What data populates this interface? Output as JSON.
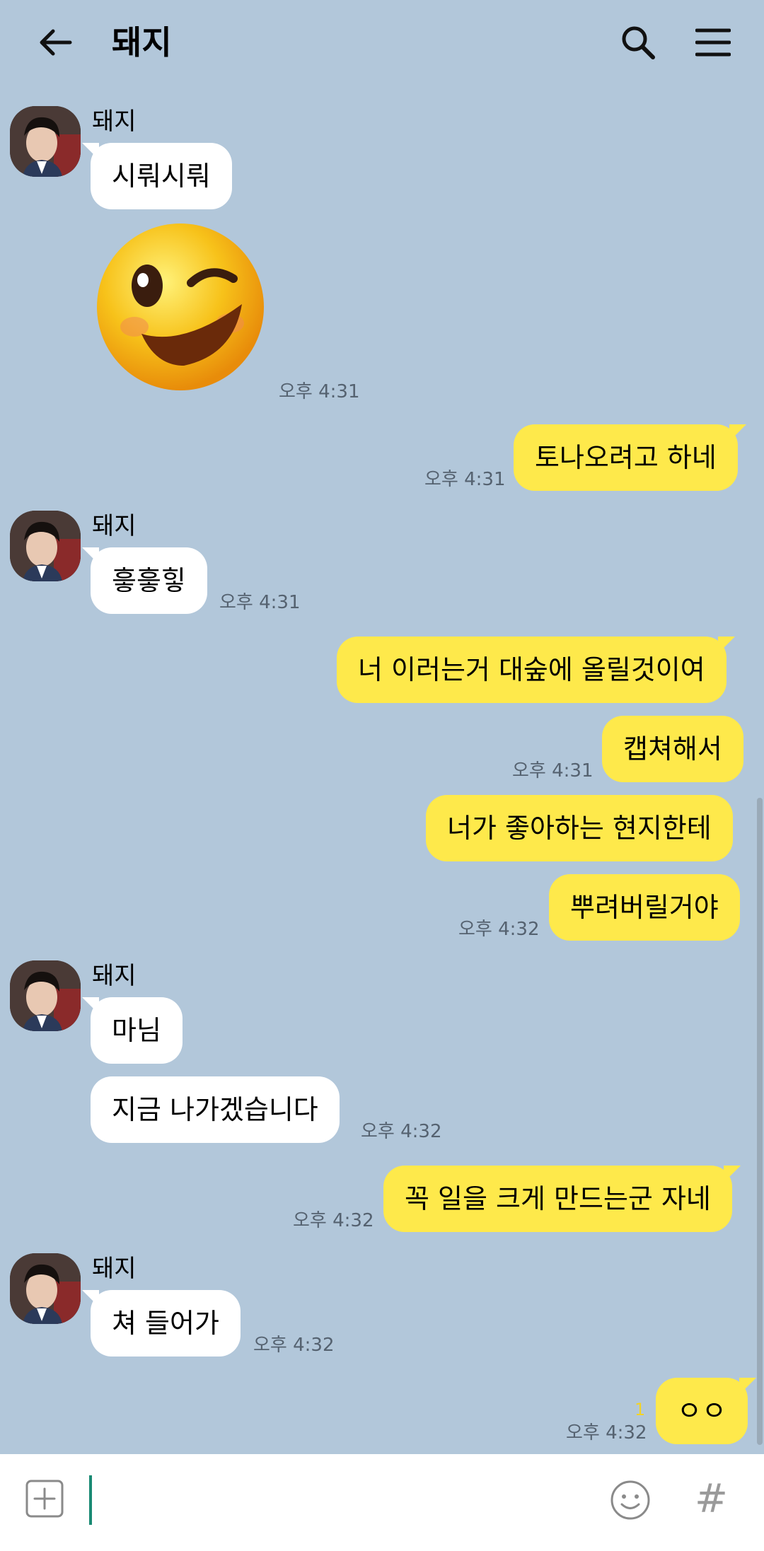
{
  "header": {
    "title": "돼지"
  },
  "messages": [
    {
      "sender": "돼지",
      "text": "시뤄시뤄"
    },
    {
      "emoji": "wink-emoji-sticker",
      "time": "오후 4:31"
    },
    {
      "text": "토나오려고 하네",
      "time": "오후 4:31"
    },
    {
      "sender": "돼지",
      "text": "흫흫힣",
      "time": "오후 4:31"
    },
    {
      "text": "너 이러는거 대숲에 올릴것이여"
    },
    {
      "text": "캡쳐해서",
      "time": "오후 4:31"
    },
    {
      "text": "너가 좋아하는 현지한테"
    },
    {
      "text": "뿌려버릴거야",
      "time": "오후 4:32"
    },
    {
      "sender": "돼지",
      "text": "마님"
    },
    {
      "text": "지금 나가겠습니다",
      "time": "오후 4:32"
    },
    {
      "text": "꼭 일을 크게 만드는군 자네",
      "time": "오후 4:32"
    },
    {
      "sender": "돼지",
      "text": "쳐 들어가",
      "time": "오후 4:32"
    },
    {
      "text": "ㅇㅇ",
      "time": "오후 4:32",
      "unread": "1"
    }
  ],
  "input": {
    "placeholder": ""
  },
  "icons": {
    "back": "back-arrow-icon",
    "search": "search-icon",
    "menu": "menu-icon",
    "add": "add-icon",
    "emoticon": "emoticon-icon",
    "hashtag": "#"
  },
  "colors": {
    "background": "#b2c7da",
    "outgoing": "#fee94b",
    "incoming": "#ffffff"
  }
}
